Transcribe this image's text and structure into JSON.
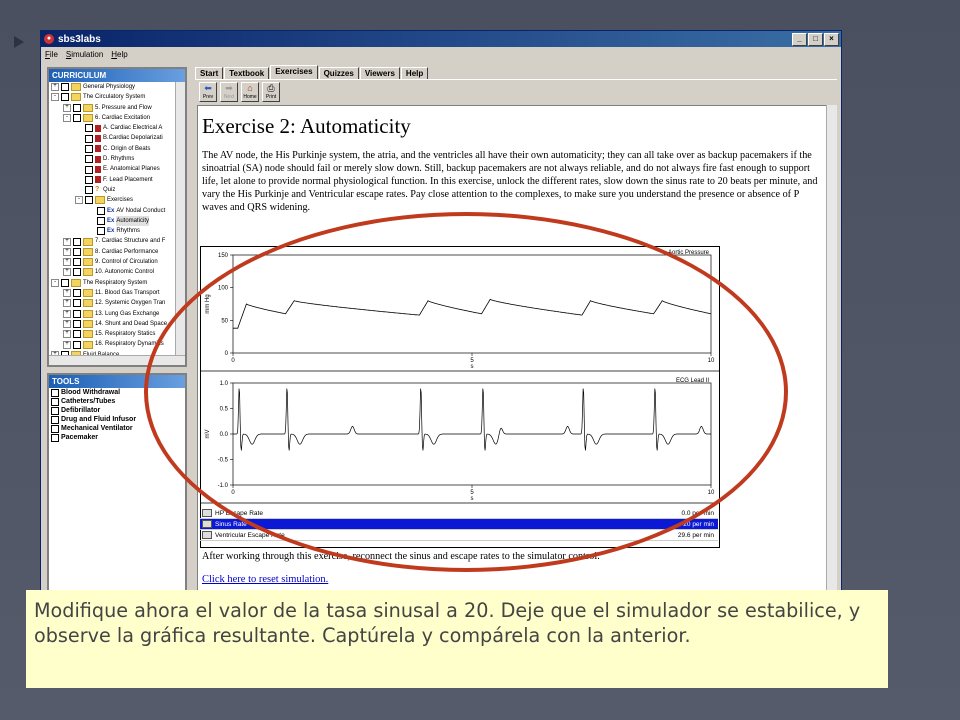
{
  "window": {
    "title": "sbs3labs",
    "menu": [
      "File",
      "Simulation",
      "Help"
    ]
  },
  "curriculum": {
    "header": "CURRICULUM",
    "tree": [
      {
        "level": 0,
        "exp": "+",
        "icon": "folder",
        "label": "General Physiology"
      },
      {
        "level": 0,
        "exp": "-",
        "icon": "folder",
        "label": "The Circulatory System"
      },
      {
        "level": 1,
        "exp": "+",
        "icon": "folder",
        "label": "5. Pressure and Flow"
      },
      {
        "level": 1,
        "exp": "-",
        "icon": "folder",
        "label": "6. Cardiac Excitation"
      },
      {
        "level": 2,
        "exp": "",
        "icon": "book",
        "label": "A. Cardiac Electrical A"
      },
      {
        "level": 2,
        "exp": "",
        "icon": "book",
        "label": "B.Cardiac Depolarizati"
      },
      {
        "level": 2,
        "exp": "",
        "icon": "book",
        "label": "C. Origin of Beats"
      },
      {
        "level": 2,
        "exp": "",
        "icon": "book",
        "label": "D. Rhythms"
      },
      {
        "level": 2,
        "exp": "",
        "icon": "book",
        "label": "E. Anatomical Planes"
      },
      {
        "level": 2,
        "exp": "",
        "icon": "book",
        "label": "F. Lead Placement"
      },
      {
        "level": 2,
        "exp": "",
        "icon": "quiz",
        "label": "Quiz"
      },
      {
        "level": 2,
        "exp": "-",
        "icon": "folder",
        "label": "Exercises"
      },
      {
        "level": 3,
        "exp": "",
        "icon": "ex",
        "label": "AV Nodal Conduct"
      },
      {
        "level": 3,
        "exp": "",
        "icon": "ex",
        "label": "Automaticity",
        "selected": true
      },
      {
        "level": 3,
        "exp": "",
        "icon": "ex",
        "label": "Rhythms"
      },
      {
        "level": 1,
        "exp": "+",
        "icon": "folder",
        "label": "7. Cardiac Structure and F"
      },
      {
        "level": 1,
        "exp": "+",
        "icon": "folder",
        "label": "8. Cardiac Performance"
      },
      {
        "level": 1,
        "exp": "+",
        "icon": "folder",
        "label": "9. Control of Circulation"
      },
      {
        "level": 1,
        "exp": "+",
        "icon": "folder",
        "label": "10. Autonomic Control"
      },
      {
        "level": 0,
        "exp": "-",
        "icon": "folder",
        "label": "The Respiratory System"
      },
      {
        "level": 1,
        "exp": "+",
        "icon": "folder",
        "label": "11. Blood Gas Transport"
      },
      {
        "level": 1,
        "exp": "+",
        "icon": "folder",
        "label": "12. Systemic Oxygen Tran"
      },
      {
        "level": 1,
        "exp": "+",
        "icon": "folder",
        "label": "13. Lung Gas Exchange"
      },
      {
        "level": 1,
        "exp": "+",
        "icon": "folder",
        "label": "14. Shunt and Dead Space"
      },
      {
        "level": 1,
        "exp": "+",
        "icon": "folder",
        "label": "15. Respiratory Statics"
      },
      {
        "level": 1,
        "exp": "+",
        "icon": "folder",
        "label": "16. Respiratory Dynamics"
      },
      {
        "level": 0,
        "exp": "+",
        "icon": "folder",
        "label": "Fluid Balance"
      }
    ]
  },
  "tools": {
    "header": "TOOLS",
    "items": [
      "Blood Withdrawal",
      "Catheters/Tubes",
      "Defibrillator",
      "Drug and Fluid Infusor",
      "Mechanical Ventilator",
      "Pacemaker"
    ]
  },
  "tabs": [
    "Start",
    "Textbook",
    "Exercises",
    "Quizzes",
    "Viewers",
    "Help"
  ],
  "toolbar": {
    "prev": "Prev",
    "next": "Next",
    "home": "Home",
    "print": "Print"
  },
  "doc": {
    "title": "Exercise 2: Automaticity",
    "paragraph": "The AV node, the His Purkinje system, the atria, and the ventricles all have their own automaticity; they can all take over as backup pacemakers if the sinoatrial (SA) node should fail or merely slow down.  Still, backup pacemakers are not always reliable, and do not always fire fast enough to support life, let alone to provide normal physiological function.  In this exercise, unlock the different rates, slow down the sinus rate to 20 beats per minute, and vary the His Purkinje and Ventricular escape rates.  Pay close attention to the complexes, to make sure you understand the presence or absence of P waves and QRS widening.",
    "after": "After working through this exercise, reconnect the sinus and escape rates to the simulator control.",
    "reset_link": "Click here to reset simulation."
  },
  "rates": [
    {
      "name": "HP Escape Rate",
      "value": "0.0",
      "unit": "per min",
      "selected": false
    },
    {
      "name": "Sinus Rate",
      "value": "20",
      "unit": "per min",
      "selected": true
    },
    {
      "name": "Ventricular Escape Rate",
      "value": "29.6",
      "unit": "per min",
      "selected": false
    }
  ],
  "chart_data": [
    {
      "type": "line",
      "title": "Aortic Pressure",
      "ylabel": "mm Hg",
      "xlabel": "s",
      "xlim": [
        0,
        10
      ],
      "ylim": [
        0,
        150
      ],
      "yticks": [
        "150",
        "100",
        "50",
        "0"
      ],
      "xticks": [
        "0",
        "5",
        "10"
      ],
      "beats": [
        0.1,
        1.1,
        3.9,
        5.2,
        7.3,
        8.8
      ],
      "diastolic": [
        38,
        60,
        58,
        60,
        58,
        60
      ],
      "systolic": [
        75,
        80,
        80,
        82,
        80,
        80
      ]
    },
    {
      "type": "line",
      "title": "ECG Lead II",
      "ylabel": "mV",
      "xlabel": "s",
      "xlim": [
        0,
        10
      ],
      "ylim": [
        -1.0,
        1.0
      ],
      "yticks": [
        "1.0",
        "0.5",
        "0.0",
        "-0.5",
        "-1.0"
      ],
      "xticks": [
        "0",
        "5",
        "10"
      ],
      "qrs": [
        0.1,
        1.1,
        3.9,
        5.2,
        7.3,
        8.8
      ],
      "p_waves": [
        2.5,
        5.6,
        7.0,
        9.8
      ]
    }
  ],
  "caption": "Modifique ahora el valor de la tasa sinusal a 20.  Deje que el simulador se estabilice, y observe la gráfica resultante. Captúrela y compárela con la anterior."
}
